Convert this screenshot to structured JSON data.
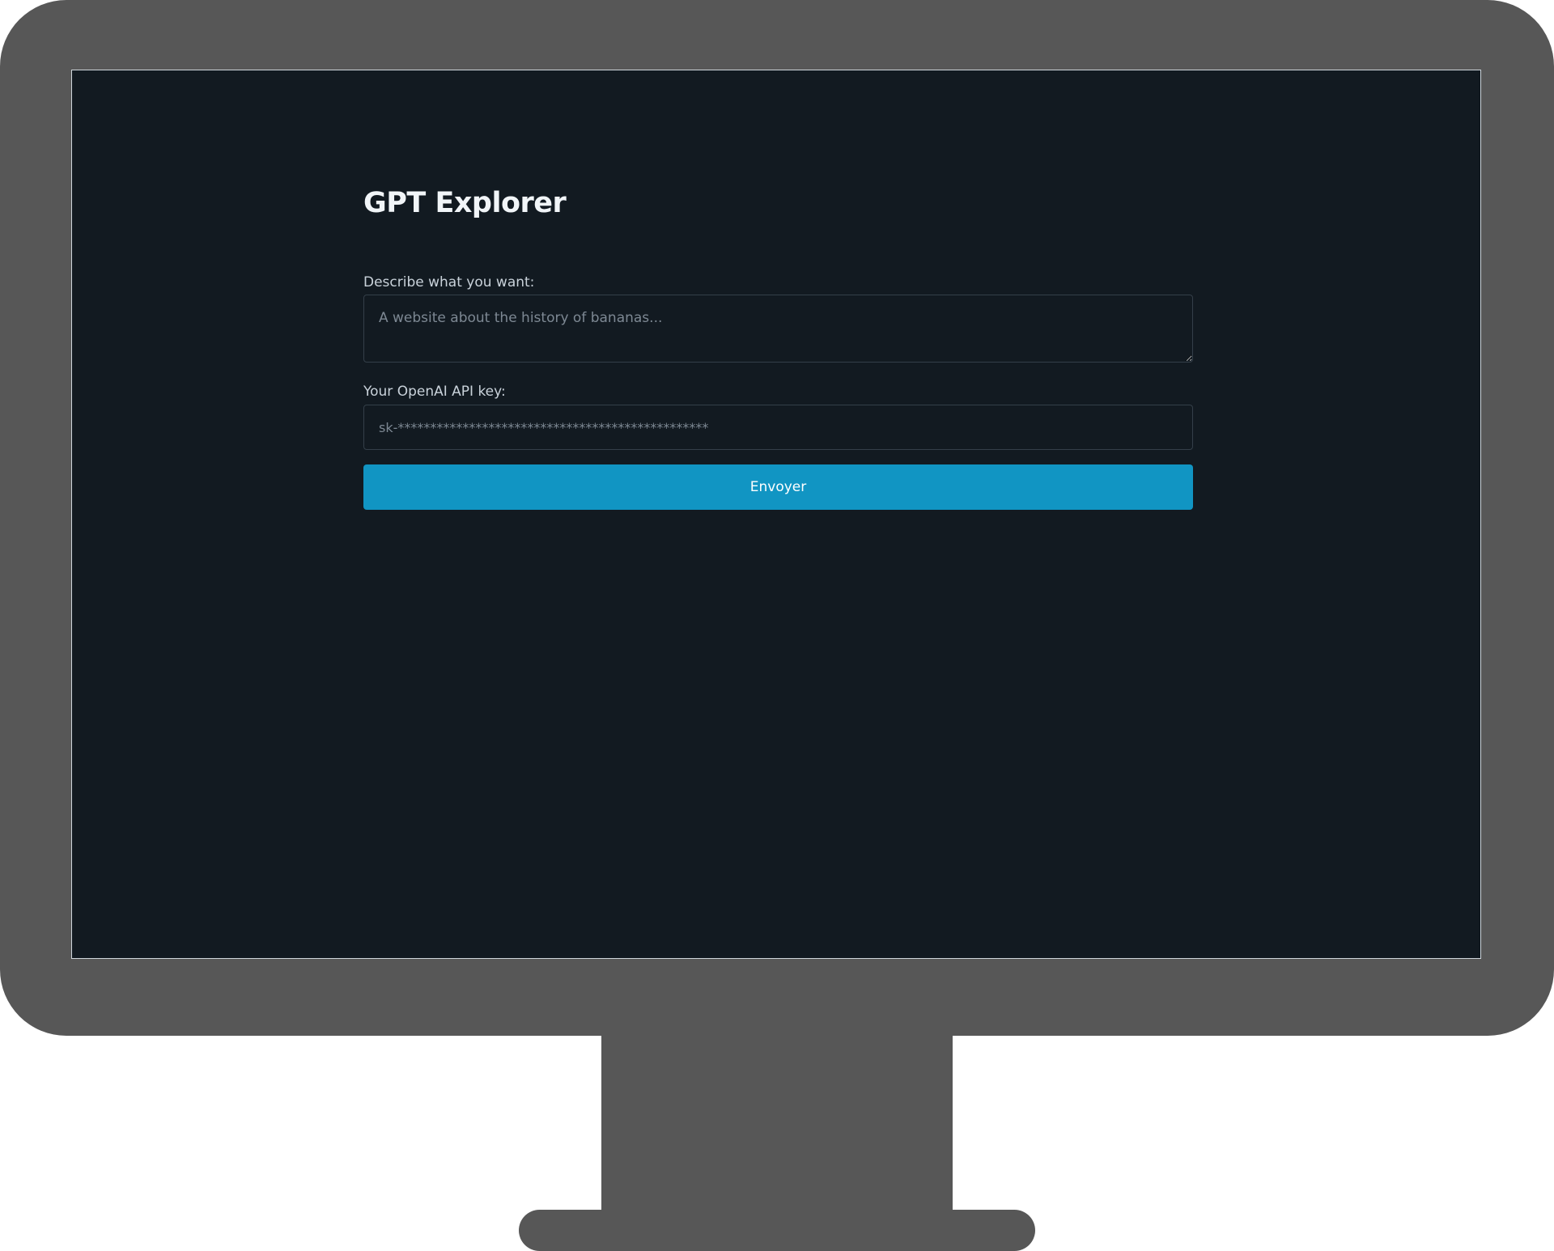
{
  "app": {
    "title": "GPT Explorer"
  },
  "form": {
    "prompt": {
      "label": "Describe what you want:",
      "value": "",
      "placeholder": "A website about the history of bananas..."
    },
    "api_key": {
      "label": "Your OpenAI API key:",
      "value": "",
      "placeholder": "sk-************************************************"
    },
    "submit_label": "Envoyer"
  },
  "colors": {
    "background": "#121a21",
    "accent": "#1195c3",
    "monitor_frame": "#575757",
    "title_text": "#f1f5f8",
    "label_text": "#c9d2da",
    "placeholder_text": "#7d8893"
  }
}
